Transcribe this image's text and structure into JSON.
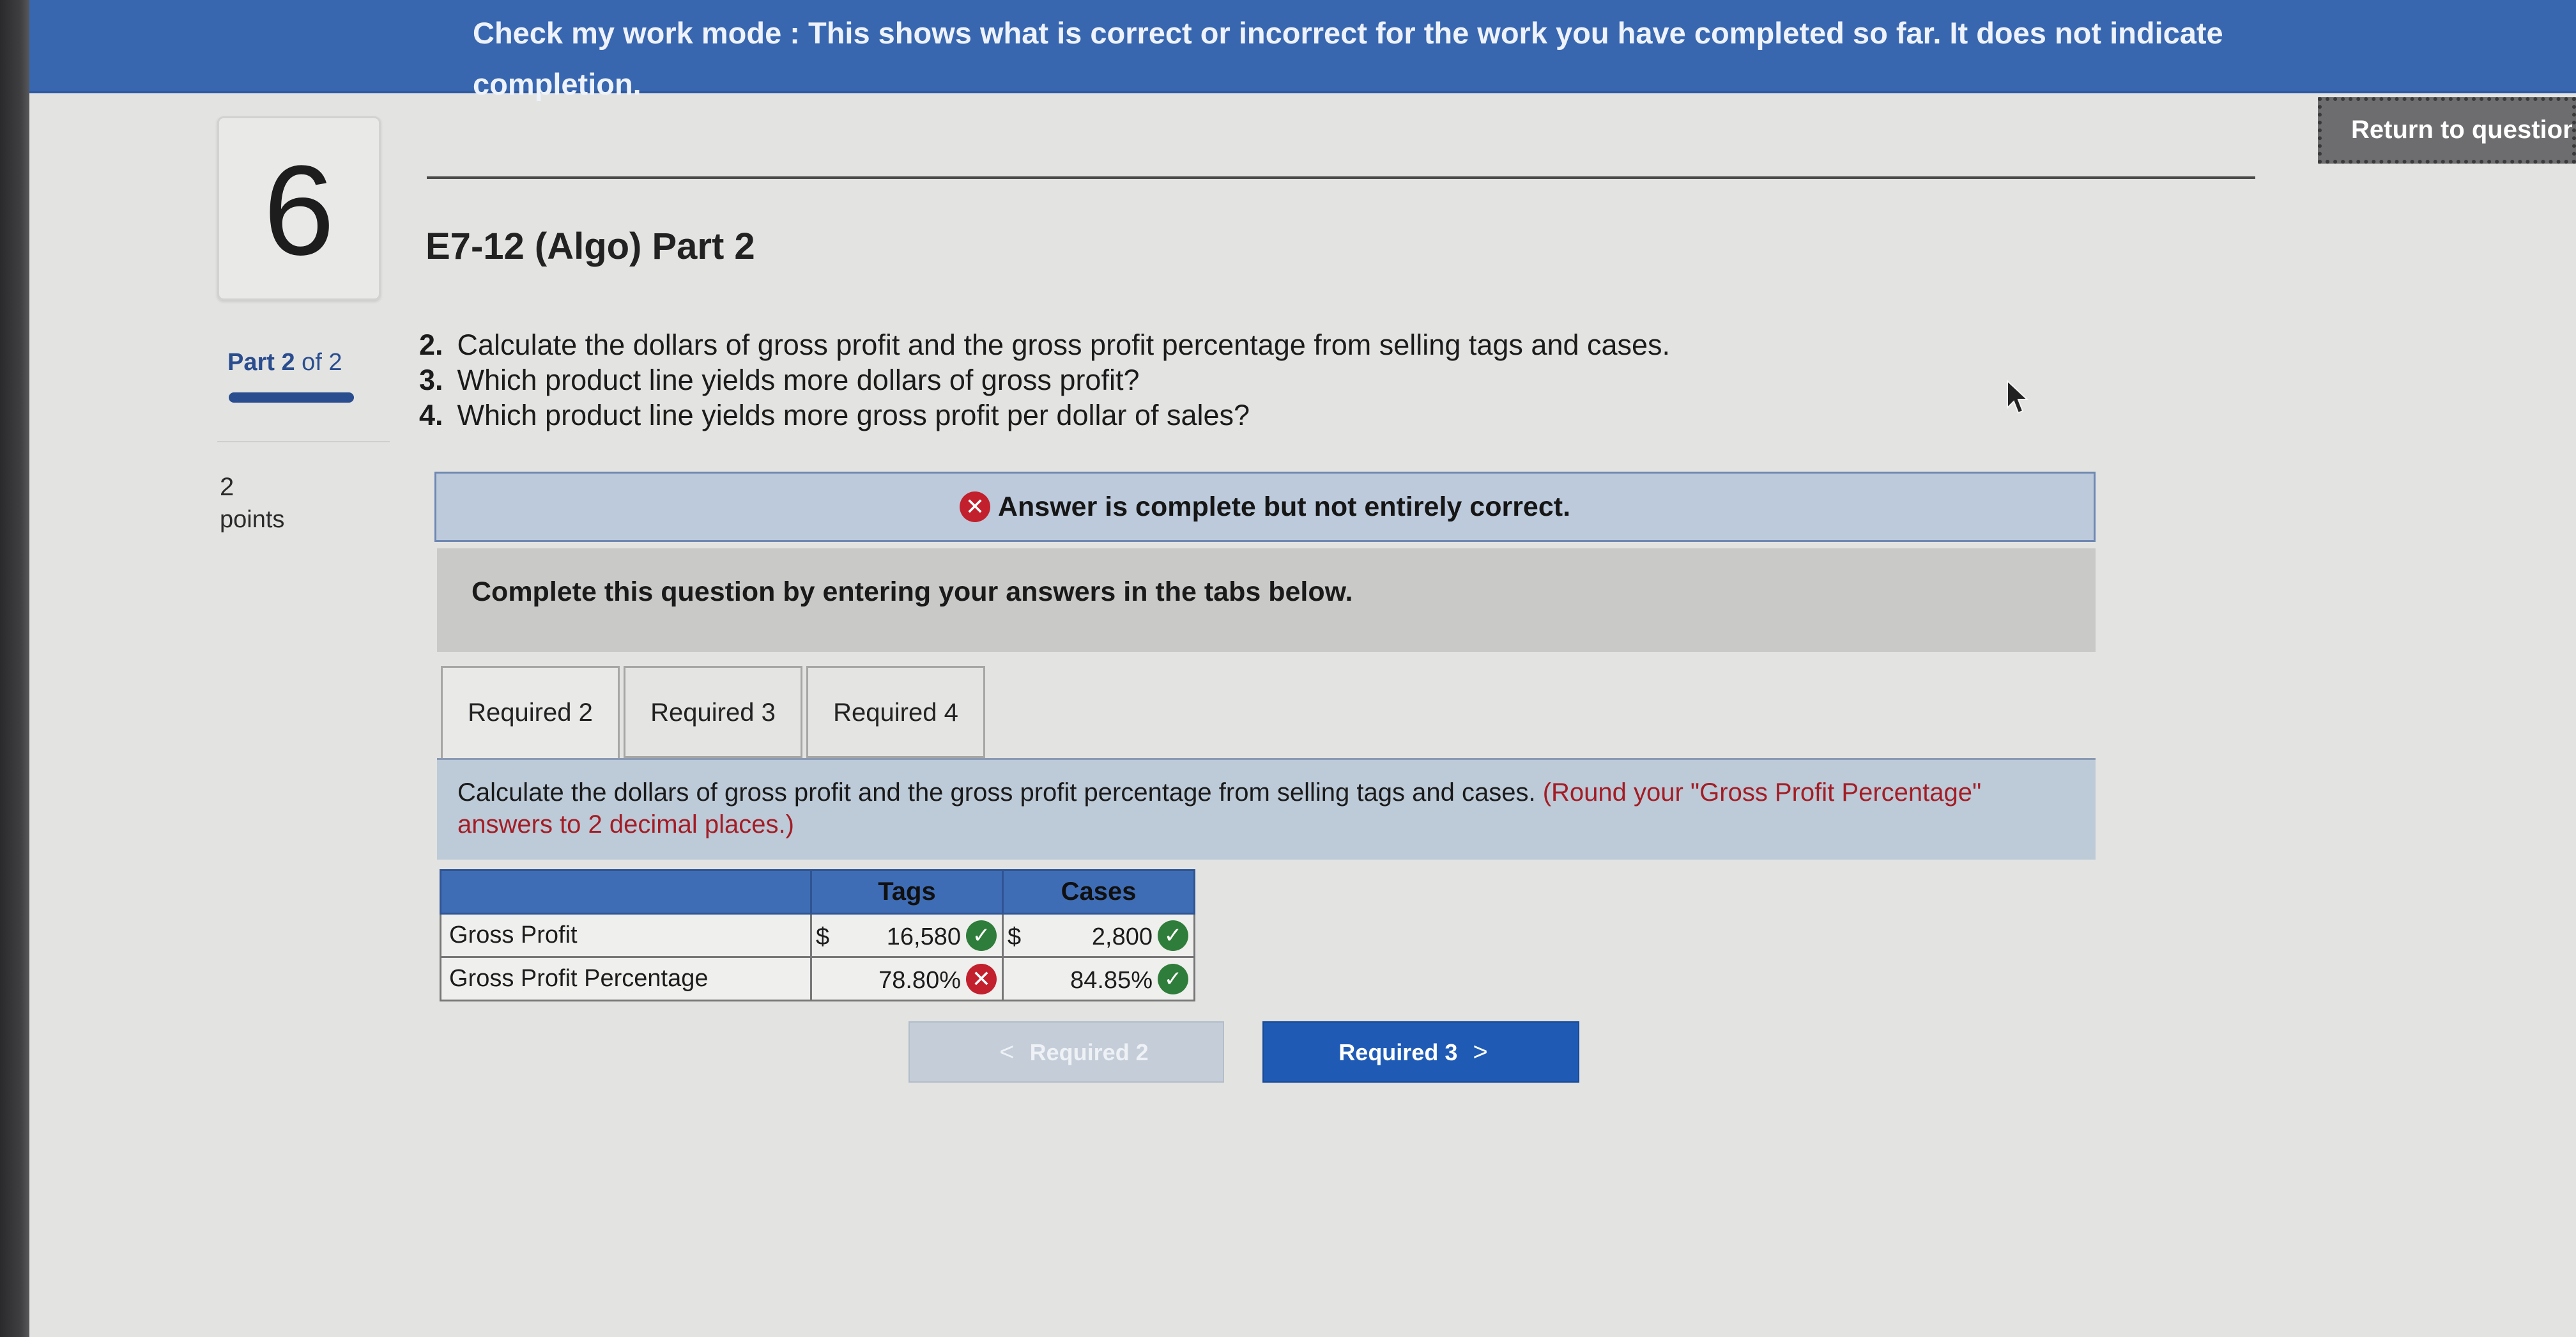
{
  "banner": {
    "text": "Check my work mode : This shows what is correct or incorrect for the work you have completed so far. It does not indicate completion."
  },
  "return_button": {
    "label": "Return to question"
  },
  "question": {
    "number": "6",
    "part_current": "Part 2",
    "part_of": " of 2",
    "points_value": "2",
    "points_label": "points",
    "title": "E7-12 (Algo) Part 2",
    "instructions": [
      {
        "num": "2.",
        "text": "Calculate the dollars of gross profit and the gross profit percentage from selling tags and cases."
      },
      {
        "num": "3.",
        "text": "Which product line yields more dollars of gross profit?"
      },
      {
        "num": "4.",
        "text": "Which product line yields more gross profit per dollar of sales?"
      }
    ]
  },
  "status": {
    "icon": "x-circle-icon",
    "text": "Answer is complete but not entirely correct."
  },
  "complete_prompt": "Complete this question by entering your answers in the tabs below.",
  "tabs": [
    {
      "label": "Required 2",
      "active": true
    },
    {
      "label": "Required 3",
      "active": false
    },
    {
      "label": "Required 4",
      "active": false
    }
  ],
  "required2": {
    "instruction": "Calculate the dollars of gross profit and the gross profit percentage from selling tags and cases.",
    "round_note": "(Round your \"Gross Profit Percentage\" answers to 2 decimal places.)"
  },
  "answer_table": {
    "headers": [
      "",
      "Tags",
      "Cases"
    ],
    "rows": [
      {
        "label": "Gross Profit",
        "tags": {
          "prefix": "$",
          "value": "16,580",
          "correct": true
        },
        "cases": {
          "prefix": "$",
          "value": "2,800",
          "correct": true
        }
      },
      {
        "label": "Gross Profit Percentage",
        "tags": {
          "prefix": "",
          "value": "78.80%",
          "correct": false
        },
        "cases": {
          "prefix": "",
          "value": "84.85%",
          "correct": true
        }
      }
    ]
  },
  "nav": {
    "prev_label": "Required 2",
    "next_label": "Required 3",
    "prev_chevron": "<",
    "next_chevron": ">"
  },
  "colors": {
    "banner": "#3867b0",
    "correct": "#2f7d3a",
    "incorrect": "#c2202c",
    "primary_button": "#1f5bb5"
  }
}
